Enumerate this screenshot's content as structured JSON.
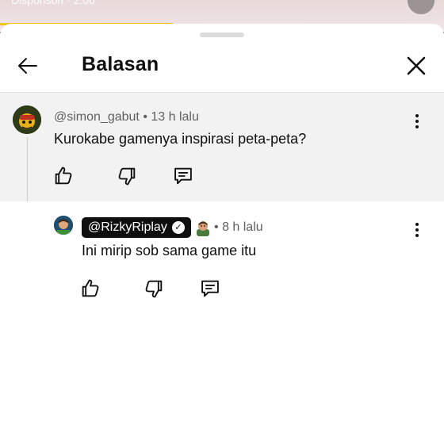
{
  "background": {
    "overlay_text": "Disponsori · 2:06"
  },
  "header": {
    "title": "Balasan"
  },
  "parent_comment": {
    "author": "@simon_gabut",
    "time": "13 h lalu",
    "text": "Kurokabe gamenya inspirasi peta-peta?"
  },
  "reply_comment": {
    "author": "@RizkyRiplay",
    "time": "8 h lalu",
    "text": "Ini mirip sob sama game itu"
  },
  "separator": "•",
  "verified_mark": "✓",
  "colors": {
    "accent_progress": "#f2c21a",
    "parent_bg": "#f2f2f2",
    "chip_bg": "#0f0f0f"
  },
  "icons": [
    "back-arrow-icon",
    "close-icon",
    "more-vert-icon",
    "like-icon",
    "dislike-icon",
    "reply-icon",
    "verified-icon",
    "member-badge-icon"
  ]
}
